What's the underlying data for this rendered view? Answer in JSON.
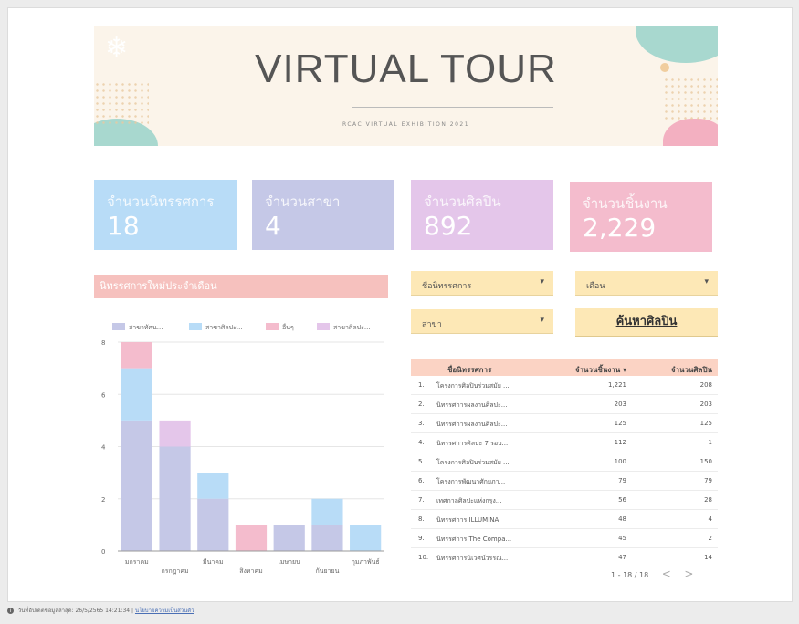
{
  "banner": {
    "title": "VIRTUAL TOUR",
    "subtitle": "RCAC VIRTUAL EXHIBITION 2021"
  },
  "kpis": [
    {
      "label": "จำนวนนิทรรศการ",
      "value": "18",
      "color": "#b8dcf7"
    },
    {
      "label": "จำนวนสาขา",
      "value": "4",
      "color": "#c5c8e7"
    },
    {
      "label": "จำนวนศิลปิน",
      "value": "892",
      "color": "#e4c6ea"
    },
    {
      "label": "จำนวนชิ้นงาน",
      "value": "2,229",
      "color": "#f4bccd"
    }
  ],
  "section_title": "นิทรรศการใหม่ประจำเดือน",
  "filters": {
    "exhibition": "ชื่อนิทรรศการ",
    "month": "เดือน",
    "branch": "สาขา",
    "caret": "▾",
    "search_button": "ค้นหาศิลปิน"
  },
  "chart_data": {
    "type": "bar",
    "stacked": true,
    "categories": [
      "มกราคม",
      "กรกฎาคม",
      "มีนาคม",
      "สิงหาคม",
      "เมษายน",
      "กันยายน",
      "กุมภาพันธ์"
    ],
    "series": [
      {
        "name": "สาขาทัศน...",
        "color": "#c5c8e7",
        "values": [
          5,
          4,
          2,
          0,
          1,
          1,
          0
        ]
      },
      {
        "name": "สาขาศิลปะ...",
        "color": "#b8dcf7",
        "values": [
          2,
          0,
          1,
          0,
          0,
          1,
          1
        ]
      },
      {
        "name": "อื่นๆ",
        "color": "#f4bccd",
        "values": [
          1,
          0,
          0,
          1,
          0,
          0,
          0
        ]
      },
      {
        "name": "สาขาศิลปะ...",
        "color": "#e4c6ea",
        "values": [
          0,
          1,
          0,
          0,
          0,
          0,
          0
        ]
      }
    ],
    "yticks": [
      "0",
      "2",
      "4",
      "6",
      "8"
    ],
    "ylim": [
      0,
      8
    ],
    "grid": true,
    "legend": "top"
  },
  "table": {
    "headers": [
      "ชื่อนิทรรศการ",
      "จำนวนชิ้นงาน ▾",
      "จำนวนศิลปิน"
    ],
    "rows": [
      [
        "1.",
        "โครงการศิลปินร่วมสมัย ...",
        "1,221",
        "208"
      ],
      [
        "2.",
        "นิทรรศการผลงานศิลปะ...",
        "203",
        "203"
      ],
      [
        "3.",
        "นิทรรศการผลงานศิลปะ...",
        "125",
        "125"
      ],
      [
        "4.",
        "นิทรรศการศิลปะ 7 รอบ...",
        "112",
        "1"
      ],
      [
        "5.",
        "โครงการศิลปินร่วมสมัย ...",
        "100",
        "150"
      ],
      [
        "6.",
        "โครงการพัฒนาศักยภา...",
        "79",
        "79"
      ],
      [
        "7.",
        "เทศกาลศิลปะแห่งกรุง...",
        "56",
        "28"
      ],
      [
        "8.",
        "นิทรรศการ ILLUMINA",
        "48",
        "4"
      ],
      [
        "9.",
        "นิทรรศการ The Compa...",
        "45",
        "2"
      ],
      [
        "10.",
        "นิทรรศการนิเวศน์วรรณ...",
        "47",
        "14"
      ]
    ],
    "pager": "1 - 18 / 18",
    "prev": "<",
    "next": ">"
  },
  "footer": {
    "updated": "วันที่อัปเดตข้อมูลล่าสุด: 26/5/2565 14:21:34",
    "sep": "|",
    "link": "นโยบายความเป็นส่วนตัว"
  }
}
